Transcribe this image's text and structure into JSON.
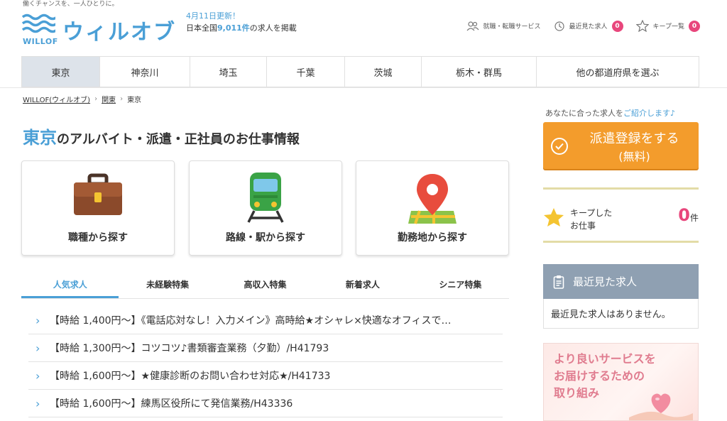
{
  "header": {
    "tagline": "働くチャンスを、一人ひとりに。",
    "logo_name": "ウィルオブ",
    "logo_sub": "WILLOF",
    "update_date": "4月11日更新！",
    "update_prefix": "日本全国",
    "update_count": "9,011件",
    "update_suffix": "の求人を掲載",
    "links": {
      "career": "就職・転職サービス",
      "recent": "最近見た求人",
      "recent_badge": "0",
      "keep": "キープ一覧",
      "keep_badge": "0"
    }
  },
  "nav": [
    "東京",
    "神奈川",
    "埼玉",
    "千葉",
    "茨城",
    "栃木・群馬",
    "他の都道府県を選ぶ"
  ],
  "breadcrumb": [
    "WILLOF(ウィルオブ)",
    "関東",
    "東京"
  ],
  "title": {
    "accent": "東京",
    "rest": "のアルバイト・派遣・正社員のお仕事情報"
  },
  "cards": [
    "職種から探す",
    "路線・駅から探す",
    "勤務地から探す"
  ],
  "tabs": [
    "人気求人",
    "未経験特集",
    "高収入特集",
    "新着求人",
    "シニア特集"
  ],
  "jobs": [
    "【時給 1,400円～】《電話応対なし！入力メイン》高時給★オシャレ×快適なオフィスで…",
    "【時給 1,300円～】コツコツ♪書類審査業務（夕勤）/H41793",
    "【時給 1,600円～】★健康診断のお問い合わせ対応★/H41733",
    "【時給 1,600円～】練馬区役所にて発信業務/H43336"
  ],
  "sidebar": {
    "intro": "あなたに合った求人を",
    "intro_highlight": "ご紹介します♪",
    "register_line1": "派遣登録をする",
    "register_line2": "(無料)",
    "keep_line1": "キープした",
    "keep_line2": "お仕事",
    "keep_count": "0",
    "keep_unit": "件",
    "recent_title": "最近見た求人",
    "recent_empty": "最近見た求人はありません。",
    "banner_line1": "より良いサービスを",
    "banner_line2": "お届けするための",
    "banner_line3": "取り組み"
  },
  "colors": {
    "accent": "#4a9fd6",
    "orange": "#f39c2c",
    "pink": "#e8467c",
    "recent_header": "#8fa0b2"
  }
}
